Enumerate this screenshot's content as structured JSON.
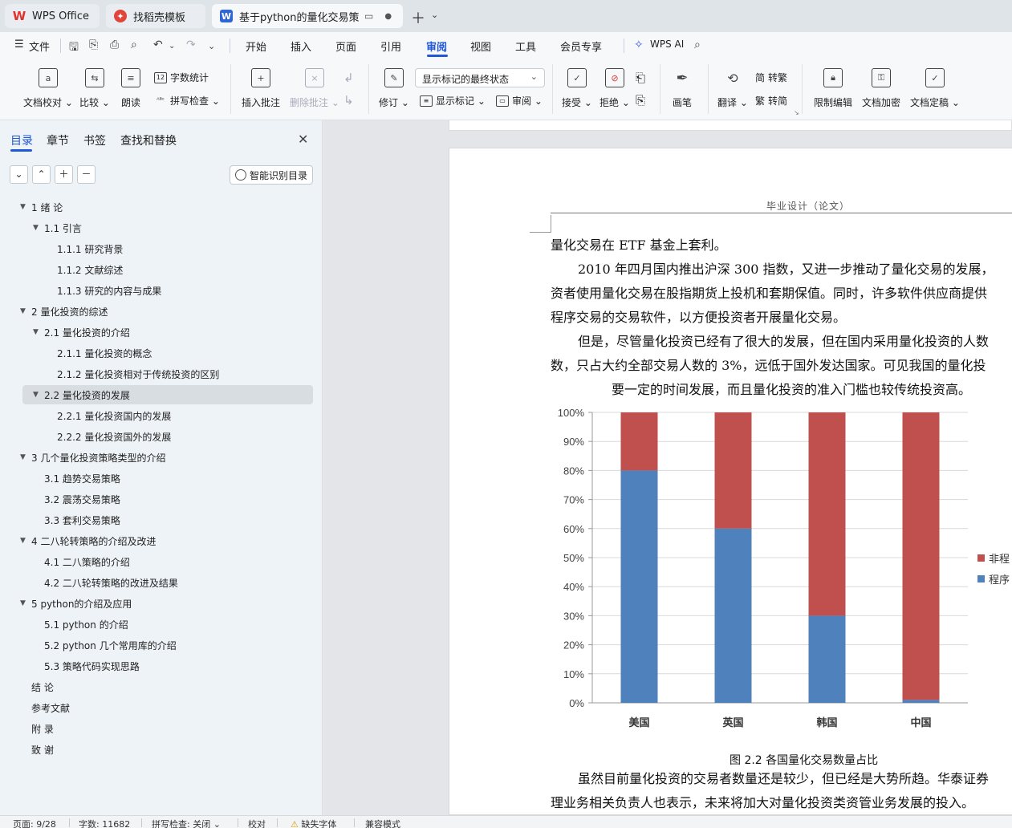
{
  "tabs": [
    {
      "label": "WPS Office"
    },
    {
      "label": "找稻壳模板"
    },
    {
      "label": "基于python的量化交易策略 毕",
      "extra": "▭"
    }
  ],
  "menubar": {
    "file": "文件",
    "items": [
      "开始",
      "插入",
      "页面",
      "引用",
      "审阅",
      "视图",
      "工具",
      "会员专享"
    ],
    "wps_ai": "WPS AI"
  },
  "ribbon": {
    "doc_proofread": "文档校对",
    "compare": "比较",
    "read_aloud": "朗读",
    "word_count": "字数统计",
    "spell_check": "拼写检查",
    "insert_comment": "插入批注",
    "delete_comment": "删除批注",
    "track_changes": "修订",
    "markup_select": "显示标记的最终状态",
    "show_markup": "显示标记",
    "review_pane": "审阅",
    "accept": "接受",
    "reject": "拒绝",
    "pen": "画笔",
    "translate": "翻译",
    "to_traditional": "转繁",
    "to_simplified": "转简",
    "trad_glyph": "简",
    "simp_glyph": "繁",
    "restrict_edit": "限制编辑",
    "doc_encrypt": "文档加密",
    "doc_finalize": "文档定稿"
  },
  "nav": {
    "tabs": [
      "目录",
      "章节",
      "书签",
      "查找和替换"
    ],
    "smart_toc": "智能识别目录",
    "toc": [
      {
        "label": "1  绪  论",
        "level": 1,
        "expanded": true
      },
      {
        "label": "1.1  引言",
        "level": 2,
        "expanded": true
      },
      {
        "label": "1.1.1  研究背景",
        "level": 3
      },
      {
        "label": "1.1.2  文献综述",
        "level": 3
      },
      {
        "label": "1.1.3  研究的内容与成果",
        "level": 3
      },
      {
        "label": "2  量化投资的综述",
        "level": 1,
        "expanded": true
      },
      {
        "label": "2.1  量化投资的介绍",
        "level": 2,
        "expanded": true
      },
      {
        "label": "2.1.1  量化投资的概念",
        "level": 3
      },
      {
        "label": "2.1.2  量化投资相对于传统投资的区别",
        "level": 3
      },
      {
        "label": "2.2  量化投资的发展",
        "level": 2,
        "expanded": true,
        "selected": true
      },
      {
        "label": "2.2.1  量化投资国内的发展",
        "level": 3
      },
      {
        "label": "2.2.2  量化投资国外的发展",
        "level": 3
      },
      {
        "label": "3  几个量化投资策略类型的介绍",
        "level": 1,
        "expanded": true
      },
      {
        "label": "3.1  趋势交易策略",
        "level": 2
      },
      {
        "label": "3.2  震荡交易策略",
        "level": 2
      },
      {
        "label": "3.3  套利交易策略",
        "level": 2
      },
      {
        "label": "4  二八轮转策略的介绍及改进",
        "level": 1,
        "expanded": true
      },
      {
        "label": "4.1  二八策略的介绍",
        "level": 2
      },
      {
        "label": "4.2  二八轮转策略的改进及结果",
        "level": 2
      },
      {
        "label": "5 python的介绍及应用",
        "level": 1,
        "expanded": true
      },
      {
        "label": "5.1 python 的介绍",
        "level": 2
      },
      {
        "label": "5.2 python 几个常用库的介绍",
        "level": 2
      },
      {
        "label": "5.3  策略代码实现思路",
        "level": 2
      },
      {
        "label": "结  论",
        "level": 1
      },
      {
        "label": "参考文献",
        "level": 1
      },
      {
        "label": "附  录",
        "level": 1
      },
      {
        "label": "致  谢",
        "level": 1
      }
    ]
  },
  "document": {
    "header": "毕业设计（论文）",
    "lines": [
      "量化交易在 ETF 基金上套利。",
      "2010 年四月国内推出沪深 300 指数，又进一步推动了量化交易的发展，",
      "资者使用量化交易在股指期货上投机和套期保值。同时，许多软件供应商提供",
      "程序交易的交易软件，以方便投资者开展量化交易。",
      "但是，尽管量化投资已经有了很大的发展，但在国内采用量化投资的人数",
      "数，只占大约全部交易人数的 3%，远低于国外发达国家。可见我国的量化投",
      "要一定的时间发展，而且量化投资的准入门槛也较传统投资高。"
    ],
    "caption": "图 2.2  各国量化交易数量占比",
    "after_lines": [
      "虽然目前量化投资的交易者数量还是较少，但已经是大势所趋。华泰证券",
      "理业务相关负责人也表示，未来将加大对量化投资类资管业务发展的投入。"
    ]
  },
  "chart_data": {
    "type": "bar",
    "stacked": true,
    "categories": [
      "美国",
      "英国",
      "韩国",
      "中国"
    ],
    "series": [
      {
        "name": "程序",
        "color": "#4f81bd",
        "values": [
          80,
          60,
          30,
          1
        ]
      },
      {
        "name": "非程",
        "color": "#c0504d",
        "values": [
          20,
          40,
          70,
          99
        ]
      }
    ],
    "y_ticks": [
      "0%",
      "10%",
      "20%",
      "30%",
      "40%",
      "50%",
      "60%",
      "70%",
      "80%",
      "90%",
      "100%"
    ],
    "ylim": [
      0,
      100
    ],
    "grid": true,
    "legend": "right"
  },
  "status": {
    "page": "页面: 9/28",
    "words": "字数: 11682",
    "spell": "拼写检查: 关闭",
    "proof": "校对",
    "missing_font": "缺失字体",
    "compat": "兼容模式"
  }
}
